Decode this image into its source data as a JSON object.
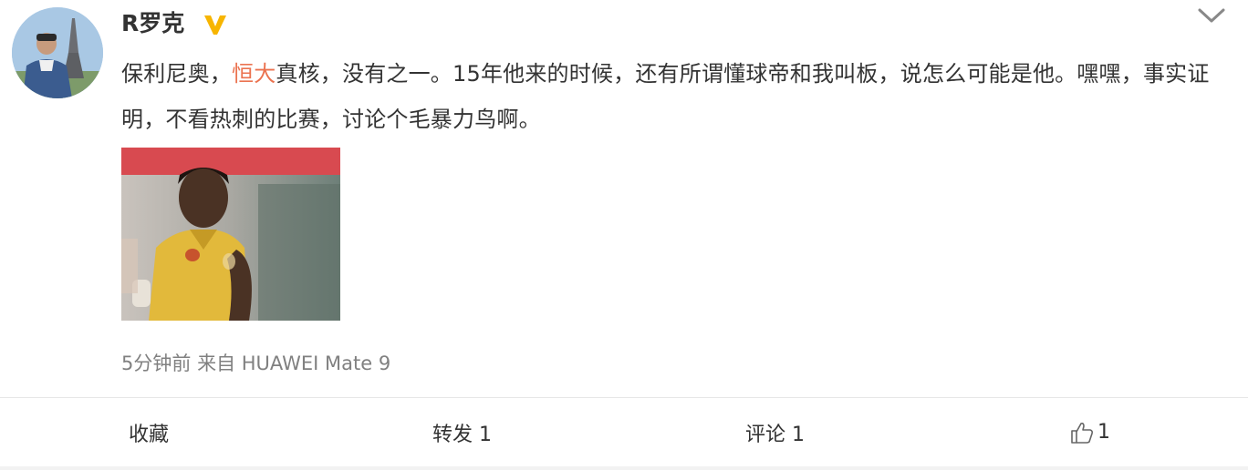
{
  "post": {
    "author": "R罗克",
    "text_before_link": "保利尼奥，",
    "topic_link": "恒大",
    "text_after_link": "真核，没有之一。15年他来的时候，还有所谓懂球帝和我叫板，说怎么可能是他。嘿嘿，事实证明，不看热刺的比赛，讨论个毛暴力鸟啊。",
    "time": "5分钟前",
    "source_prefix": "来自",
    "source_device": "HUAWEI Mate 9"
  },
  "actions": {
    "favorite_label": "收藏",
    "repost_label": "转发 1",
    "comment_label": "评论 1",
    "like_count": "1"
  },
  "colors": {
    "text": "#333333",
    "link": "#eb7350",
    "meta": "#808080",
    "verified_badge": "#f7b500"
  },
  "icons": {
    "verified": "verified-v-icon",
    "menu": "chevron-down-icon",
    "like": "thumbs-up-icon"
  }
}
